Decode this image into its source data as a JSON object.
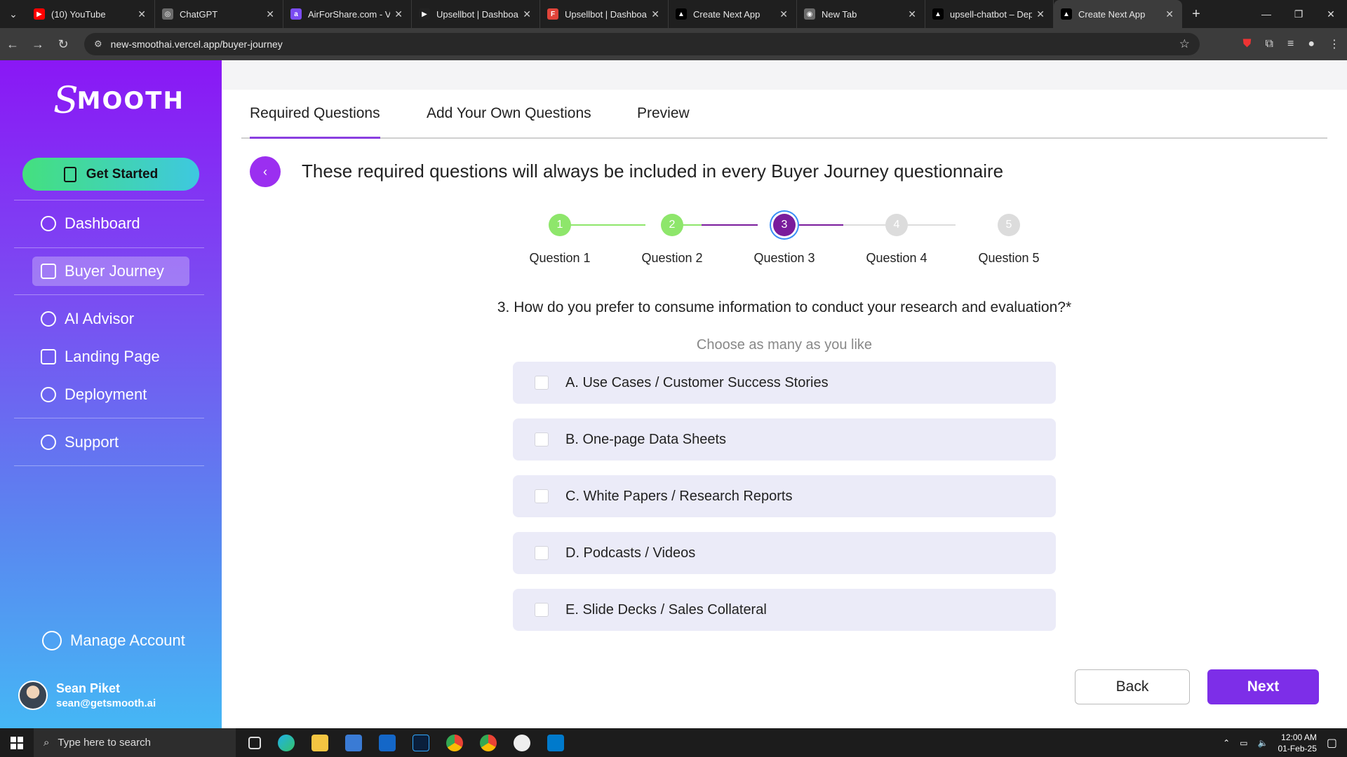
{
  "browser": {
    "tabs": [
      {
        "title": "(10) YouTube",
        "fav_color": "#ff0000"
      },
      {
        "title": "ChatGPT",
        "fav_color": "#6b6b6b"
      },
      {
        "title": "AirForShare.com - Vi",
        "fav_color": "#7b4cf2"
      },
      {
        "title": "Upsellbot | Dashboa",
        "fav_color": "#222222"
      },
      {
        "title": "Upsellbot | Dashboa",
        "fav_color": "#e0443a"
      },
      {
        "title": "Create Next App",
        "fav_color": "#000000"
      },
      {
        "title": "New Tab",
        "fav_color": "#6b6b6b"
      },
      {
        "title": "upsell-chatbot – Dep",
        "fav_color": "#000000"
      },
      {
        "title": "Create Next App",
        "fav_color": "#000000"
      }
    ],
    "url": "new-smoothai.vercel.app/buyer-journey"
  },
  "sidebar": {
    "logo": "MOOTH",
    "get_started": "Get Started",
    "nav": [
      "Dashboard",
      "Buyer Journey",
      "AI Advisor",
      "Landing Page",
      "Deployment",
      "Support"
    ],
    "manage_account": "Manage Account",
    "user_name": "Sean Piket",
    "user_email": "sean@getsmooth.ai"
  },
  "main": {
    "tabs": [
      "Required Questions",
      "Add Your Own Questions",
      "Preview"
    ],
    "headline": "These required questions will always be included in every Buyer Journey questionnaire",
    "steps": [
      {
        "num": "1",
        "label": "Question 1"
      },
      {
        "num": "2",
        "label": "Question 2"
      },
      {
        "num": "3",
        "label": "Question 3"
      },
      {
        "num": "4",
        "label": "Question 4"
      },
      {
        "num": "5",
        "label": "Question 5"
      }
    ],
    "question": "3. How do you prefer to consume information to conduct your research and evaluation?*",
    "hint": "Choose as many as you like",
    "options": [
      "A. Use Cases / Customer Success Stories",
      "B. One-page Data Sheets",
      "C. White Papers / Research Reports",
      "D. Podcasts / Videos",
      "E. Slide Decks / Sales Collateral"
    ],
    "back_label": "Back",
    "next_label": "Next"
  },
  "taskbar": {
    "search_placeholder": "Type here to search",
    "time": "12:00 AM",
    "date": "01-Feb-25"
  },
  "colors": {
    "accent": "#7d2ee8",
    "done_step": "#8ee66b",
    "current_step": "#7a1c9c"
  }
}
